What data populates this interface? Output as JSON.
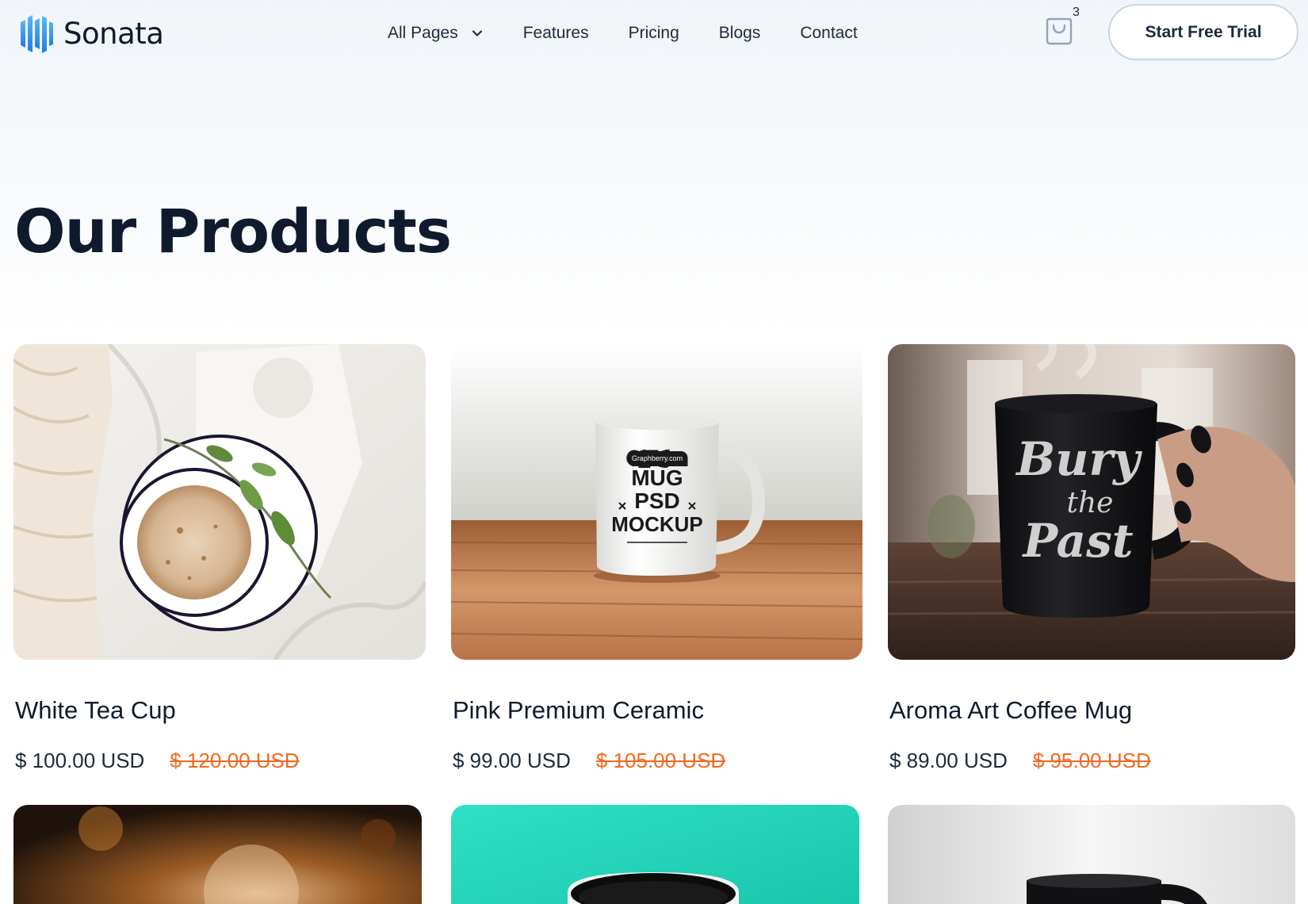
{
  "brand": {
    "name": "Sonata",
    "accent": "#2f8fe6"
  },
  "nav": {
    "items": [
      {
        "label": "All Pages",
        "dropdown": true
      },
      {
        "label": "Features"
      },
      {
        "label": "Pricing"
      },
      {
        "label": "Blogs"
      },
      {
        "label": "Contact"
      }
    ],
    "cart": {
      "icon": "shopping-bag-icon",
      "count": "3"
    },
    "cta": "Start Free Trial"
  },
  "page": {
    "title": "Our Products"
  },
  "colors": {
    "heading": "#0f1b2d",
    "sale": "#f26a21"
  },
  "products": [
    {
      "name": "White Tea Cup",
      "price": "$ 100.00 USD",
      "old_price": "$ 120.00 USD",
      "image": "latte-cup-on-saucer"
    },
    {
      "name": "Pink Premium Ceramic",
      "price": "$ 99.00 USD",
      "old_price": "$ 105.00 USD",
      "image": "white-mug-mockup",
      "image_text": [
        "Graphberry.com",
        "MUG",
        "PSD",
        "MOCKUP"
      ]
    },
    {
      "name": "Aroma Art Coffee Mug",
      "price": "$ 89.00 USD",
      "old_price": "$ 95.00 USD",
      "image": "black-mug-in-hand",
      "image_text": [
        "Bury",
        "the",
        "Past"
      ]
    },
    {
      "image": "blurred-warm-scene"
    },
    {
      "image": "black-white-mug-teal"
    },
    {
      "image": "black-mug-grey"
    }
  ]
}
